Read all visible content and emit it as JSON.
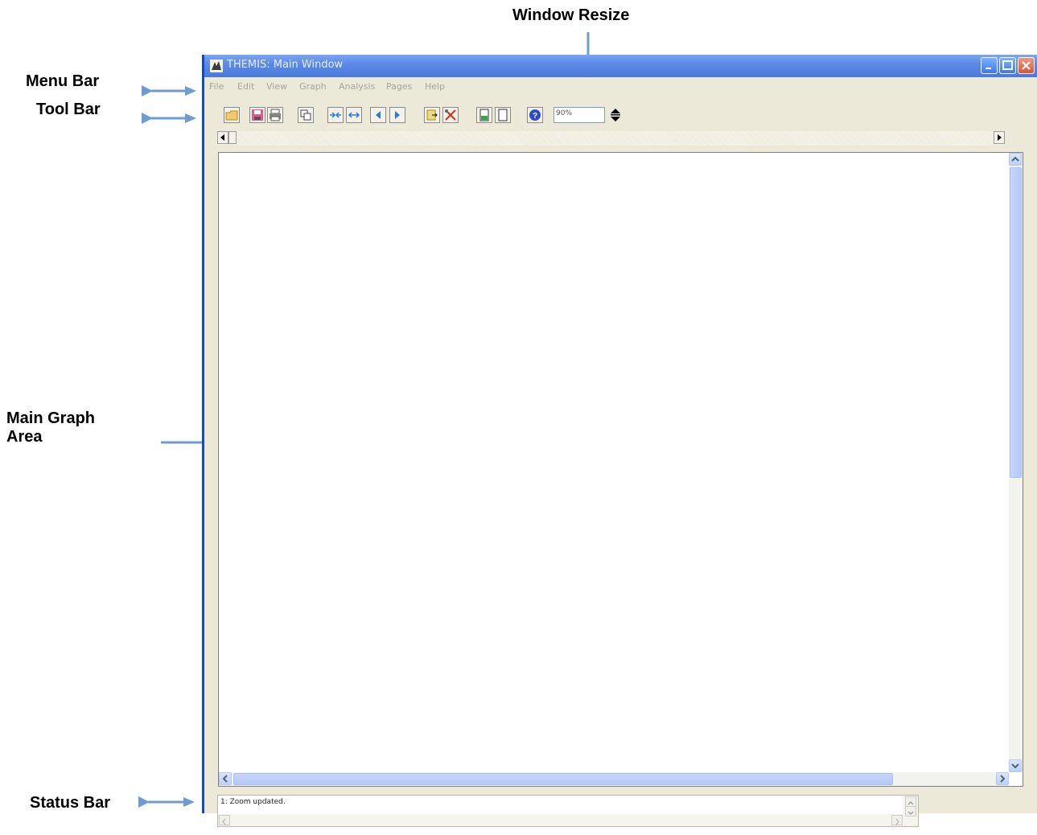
{
  "annotations": {
    "window_resize": "Window Resize",
    "menu_bar": "Menu Bar",
    "tool_bar": "Tool Bar",
    "main_graph_area_line1": "Main Graph",
    "main_graph_area_line2": "Area",
    "status_bar": "Status Bar"
  },
  "window": {
    "title": "THEMIS: Main Window"
  },
  "menu": {
    "items": [
      "File",
      "Edit",
      "View",
      "Graph",
      "Analysis",
      "Pages",
      "Help"
    ]
  },
  "toolbar": {
    "zoom_value": "90%",
    "icons": [
      "open-icon",
      "save-icon",
      "print-icon",
      "copy-icon",
      "collapse-icon",
      "expand-icon",
      "prev-page-icon",
      "next-page-icon",
      "export-icon",
      "settings-icon",
      "color-page-icon",
      "blank-page-icon",
      "help-icon"
    ]
  },
  "status": {
    "message": "1: Zoom updated."
  },
  "colors": {
    "titlebar": "#5b8ae8",
    "window_bg": "#ece9d8",
    "annotation_arrow": "#6f9bd3"
  }
}
